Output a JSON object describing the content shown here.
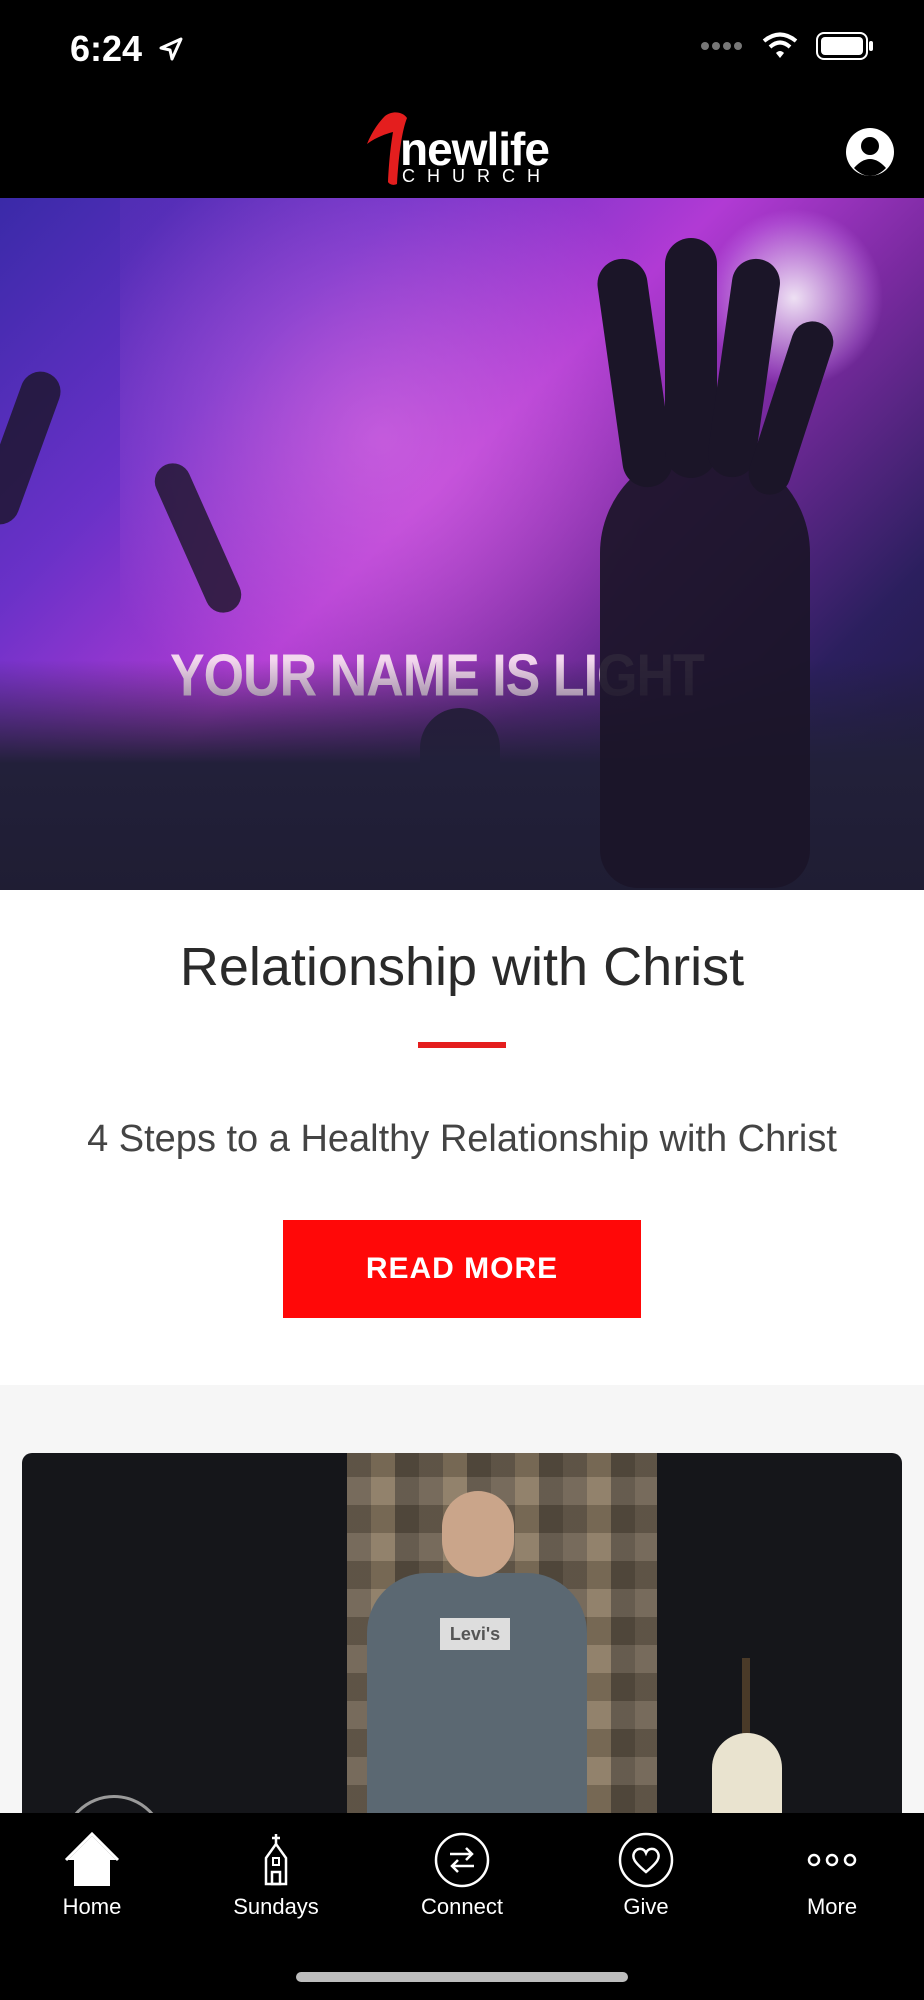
{
  "status": {
    "time": "6:24"
  },
  "header": {
    "logo_main": "newlife",
    "logo_sub": "CHURCH"
  },
  "hero": {
    "image_text": "YOUR NAME IS LIGHT"
  },
  "article": {
    "title": "Relationship with Christ",
    "subtitle": "4 Steps to a Healthy Relationship with Christ",
    "button_label": "READ MORE"
  },
  "video": {
    "shirt_text": "Levi's"
  },
  "tabs": [
    {
      "label": "Home",
      "icon": "home-icon"
    },
    {
      "label": "Sundays",
      "icon": "church-icon"
    },
    {
      "label": "Connect",
      "icon": "connect-icon"
    },
    {
      "label": "Give",
      "icon": "heart-icon"
    },
    {
      "label": "More",
      "icon": "more-icon"
    }
  ],
  "colors": {
    "accent": "#ff0808",
    "divider": "#e41e1e",
    "bars": "#000000"
  }
}
